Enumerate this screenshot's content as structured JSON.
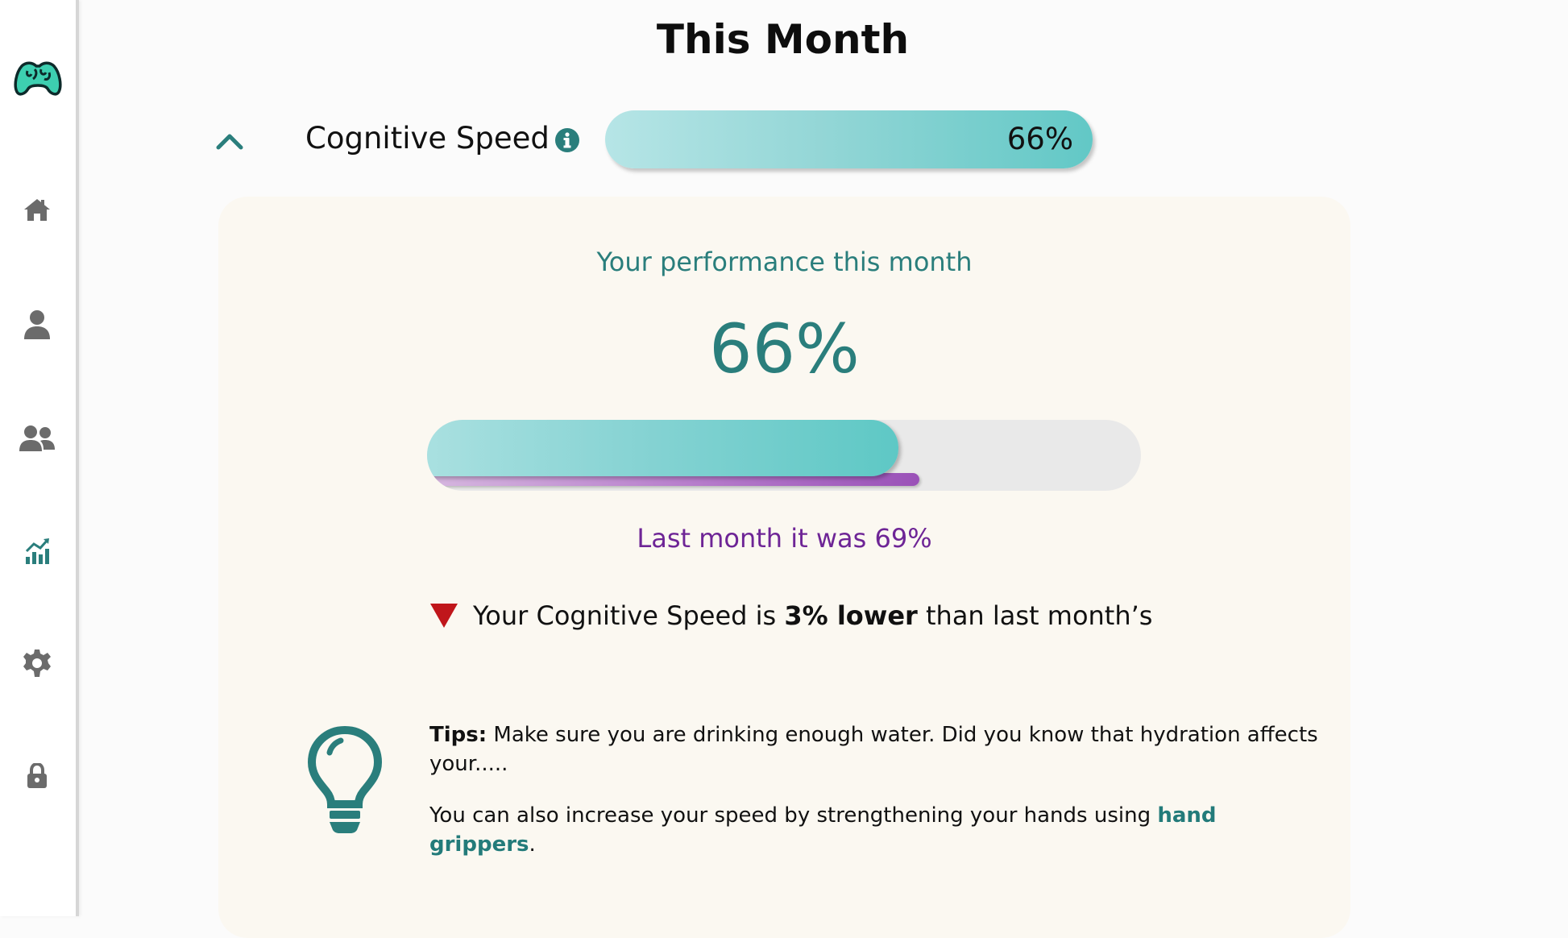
{
  "page": {
    "title": "This Month"
  },
  "sidebar": {
    "items": [
      {
        "icon": "home-icon"
      },
      {
        "icon": "person-icon"
      },
      {
        "icon": "group-icon"
      },
      {
        "icon": "stats-chart-icon",
        "active": true
      },
      {
        "icon": "gear-icon"
      },
      {
        "icon": "lock-icon"
      }
    ]
  },
  "metric": {
    "name": "Cognitive Speed",
    "value_label": "66%",
    "value_fraction": 0.66
  },
  "card": {
    "performance_label": "Your performance this month",
    "big_value": "66%",
    "current_fraction": 0.66,
    "last_fraction": 0.69,
    "last_month_text": "Last month it was 69%",
    "comparison": {
      "prefix": "Your Cognitive Speed is ",
      "bold": "3% lower",
      "suffix": " than last month’s"
    },
    "tips": {
      "label": "Tips:",
      "text": " Make sure you are drinking enough water. Did you know that hydration affects your.....",
      "line2_prefix": "You can also increase your speed by strengthening your hands using ",
      "link_text": "hand grippers",
      "line2_suffix": "."
    }
  },
  "colors": {
    "teal": "#2a7e7c",
    "teal_bar": "#62c8c6",
    "purple": "#6e2596",
    "down_red": "#c0161b",
    "icon_gray": "#6b6b6b"
  }
}
